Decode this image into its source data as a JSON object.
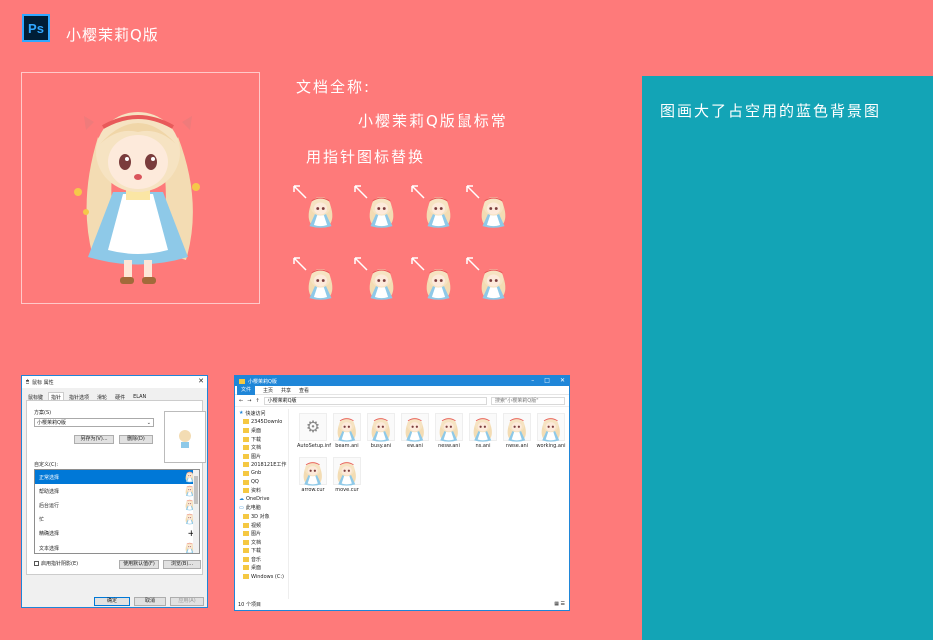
{
  "header": {
    "logo_text": "Ps",
    "brand_title": "小樱茉莉Q版"
  },
  "description": {
    "label": "文档全称:",
    "line1": "小樱茉莉Q版鼠标常",
    "line2": "用指针图标替换"
  },
  "side_panel": {
    "title": "图画大了占空用的蓝色背景图"
  },
  "colors": {
    "background": "#fe7a7a",
    "panel": "#13a4b6",
    "accent": "#1f86d8"
  },
  "mouse_properties": {
    "title": "鼠标 属性",
    "tabs": [
      "鼠标键",
      "指针",
      "指针选项",
      "滑轮",
      "硬件",
      "ELAN"
    ],
    "scheme_label": "方案(S)",
    "scheme_value": "小樱茉莉Q版",
    "save_as": "另存为(V)...",
    "delete": "删除(D)",
    "customize_label": "自定义(C):",
    "cursor_roles": [
      "正常选择",
      "帮助选择",
      "后台运行",
      "忙",
      "精确选择",
      "文本选择"
    ],
    "shadow_checkbox": "启用指针阴影(E)",
    "use_default": "使用默认值(F)",
    "browse": "浏览(B)...",
    "ok": "确定",
    "cancel": "取消",
    "apply": "应用(A)"
  },
  "explorer": {
    "title": "小樱茉莉Q版",
    "ribbon": [
      "文件",
      "主页",
      "共享",
      "查看"
    ],
    "address": "小樱茉莉Q版",
    "search_placeholder": "搜索\"小樱茉莉Q版\"",
    "nav": {
      "quick_access": "快速访问",
      "quick_items": [
        "2345Downlo",
        "桌面",
        "下载",
        "文档",
        "图片",
        "2018121E工作",
        "Gnb",
        "QQ",
        "资料"
      ],
      "onedrive": "OneDrive",
      "this_pc": "此电脑",
      "pc_items": [
        "3D 对象",
        "视频",
        "图片",
        "文档",
        "下载",
        "音乐",
        "桌面",
        "Windows (C:)"
      ]
    },
    "files_row1": [
      "AutoSetup.inf",
      "beam.ani",
      "busy.ani",
      "ew.ani",
      "nesw.ani",
      "ns.ani",
      "nwse.ani",
      "working.ani"
    ],
    "files_row2": [
      "arrow.cur",
      "move.cur"
    ],
    "status": "10 个项目"
  }
}
